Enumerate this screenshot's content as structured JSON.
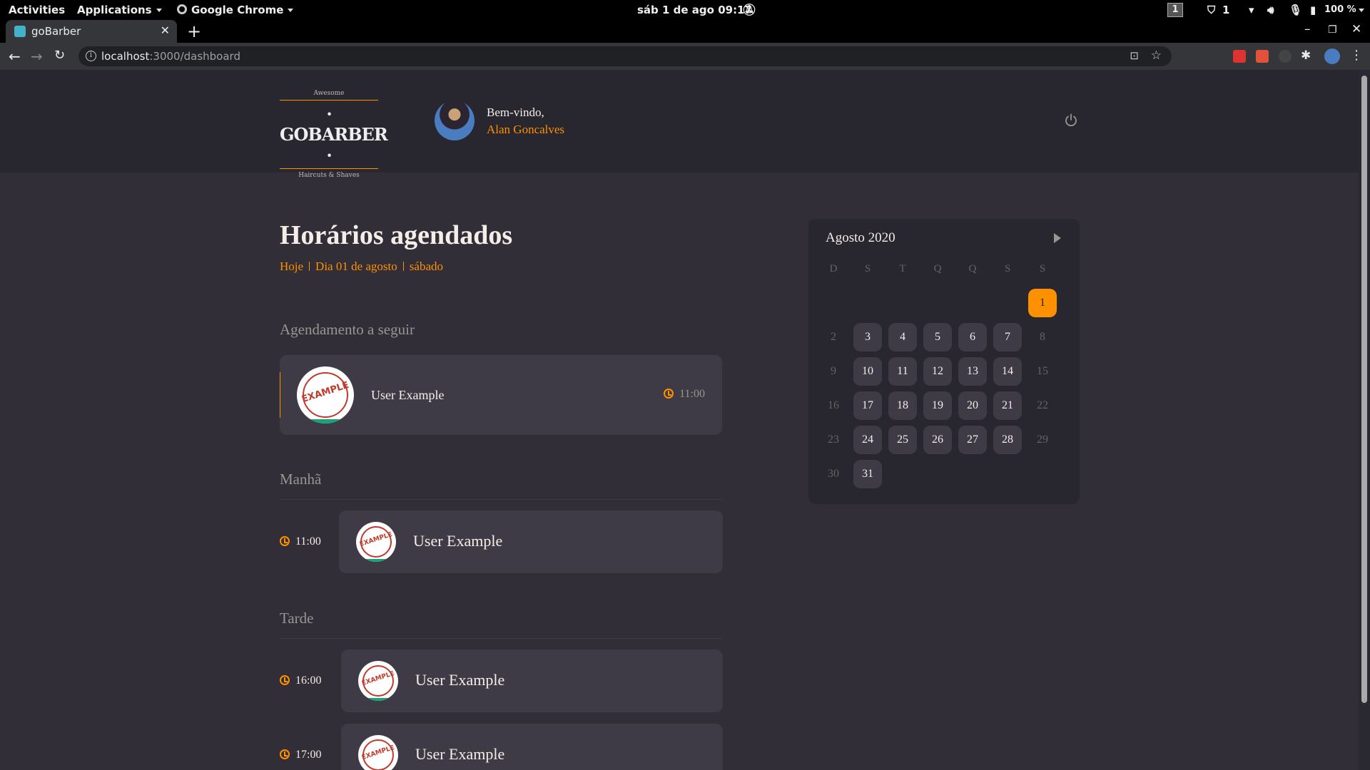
{
  "system_bar": {
    "activities": "Activities",
    "applications": "Applications",
    "browser_menu": "Google Chrome",
    "clock": "sáb 1 de ago  09:17",
    "workspace": "1",
    "shield_count": "1",
    "battery": "100 %"
  },
  "browser": {
    "tab_title": "goBarber",
    "url_host": "localhost",
    "url_path": ":3000/dashboard"
  },
  "header": {
    "logo_top": "Awesome",
    "logo_main": "· GOBARBER ·",
    "logo_bottom": "Haircuts & Shaves",
    "welcome": "Bem-vindo,",
    "user_name": "Alan Goncalves"
  },
  "schedule": {
    "title": "Horários agendados",
    "subtitle": [
      "Hoje",
      "Dia 01 de agosto",
      "sábado"
    ],
    "next_label": "Agendamento a seguir",
    "next": {
      "name": "User Example",
      "time": "11:00",
      "stamp": "EXAMPLE"
    },
    "morning_label": "Manhã",
    "morning": [
      {
        "time": "11:00",
        "name": "User Example",
        "stamp": "EXAMPLE"
      }
    ],
    "afternoon_label": "Tarde",
    "afternoon": [
      {
        "time": "16:00",
        "name": "User Example",
        "stamp": "EXAMPLE"
      },
      {
        "time": "17:00",
        "name": "User Example",
        "stamp": "EXAMPLE"
      }
    ]
  },
  "calendar": {
    "month_label": "Agosto 2020",
    "weekdays": [
      "D",
      "S",
      "T",
      "Q",
      "Q",
      "S",
      "S"
    ],
    "selected_day": "1",
    "weeks": [
      [
        "",
        "",
        "",
        "",
        "",
        "",
        "1"
      ],
      [
        "2",
        "3",
        "4",
        "5",
        "6",
        "7",
        "8"
      ],
      [
        "9",
        "10",
        "11",
        "12",
        "13",
        "14",
        "15"
      ],
      [
        "16",
        "17",
        "18",
        "19",
        "20",
        "21",
        "22"
      ],
      [
        "23",
        "24",
        "25",
        "26",
        "27",
        "28",
        "29"
      ],
      [
        "30",
        "31",
        "",
        "",
        "",
        "",
        ""
      ]
    ]
  },
  "colors": {
    "accent": "#ff9000",
    "background": "#312e38",
    "card": "#3e3b47",
    "header": "#28262e"
  }
}
